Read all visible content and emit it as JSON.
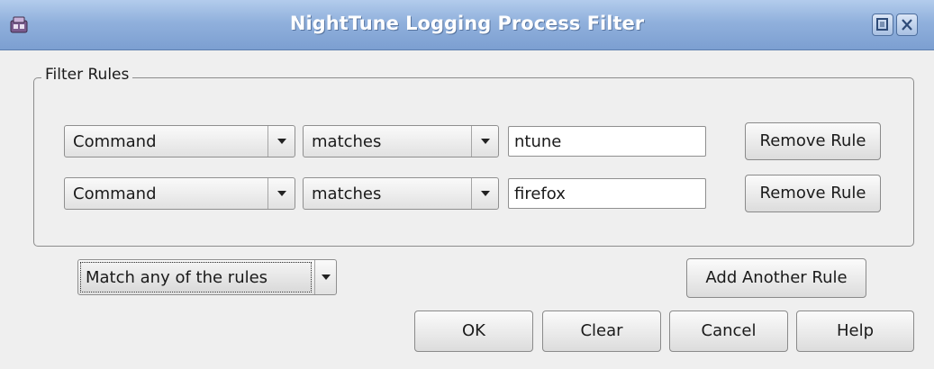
{
  "window": {
    "title": "NightTune Logging Process Filter",
    "icon": "nighttune-app-icon",
    "controls": [
      "maximize-icon",
      "close-icon"
    ]
  },
  "group": {
    "title": "Filter Rules"
  },
  "rules": [
    {
      "field": "Command",
      "operator": "matches",
      "value": "ntune",
      "remove_label": "Remove Rule"
    },
    {
      "field": "Command",
      "operator": "matches",
      "value": "firefox",
      "remove_label": "Remove Rule"
    }
  ],
  "match_mode": {
    "selected": "Match any of the rules"
  },
  "buttons": {
    "add_rule": "Add Another Rule",
    "ok": "OK",
    "clear": "Clear",
    "cancel": "Cancel",
    "help": "Help"
  },
  "colors": {
    "titlebar": "#90b0dc",
    "background": "#efefef"
  }
}
